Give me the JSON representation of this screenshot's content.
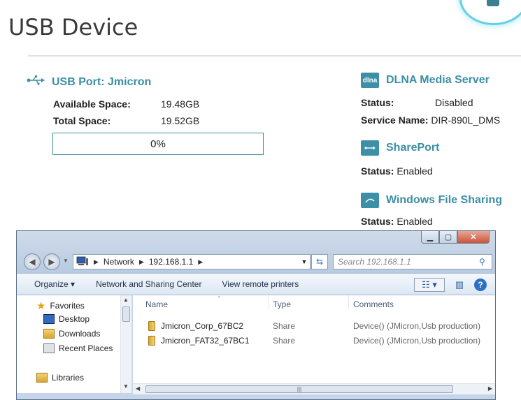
{
  "page": {
    "title": "USB Device"
  },
  "usb": {
    "port_label": "USB Port: Jmicron",
    "available_label": "Available Space:",
    "available_value": "19.48GB",
    "total_label": "Total Space:",
    "total_value": "19.52GB",
    "usage_text": "0%",
    "usage_fraction": 0
  },
  "dlna": {
    "title": "DLNA Media Server",
    "icon_text": "dlna",
    "status_label": "Status:",
    "status_value": "Disabled",
    "service_label": "Service Name:",
    "service_value": "DIR-890L_DMS"
  },
  "shareport": {
    "title": "SharePort",
    "status_label": "Status:",
    "status_value": "Enabled"
  },
  "wfs": {
    "title": "Windows File Sharing",
    "status_label": "Status:",
    "status_value": "Enabled"
  },
  "explorer": {
    "address": [
      "Network",
      "192.168.1.1"
    ],
    "search_placeholder": "Search 192.168.1.1",
    "toolbar": {
      "organize": "Organize",
      "network_center": "Network and Sharing Center",
      "remote_printers": "View remote printers"
    },
    "nav": {
      "favorites": "Favorites",
      "desktop": "Desktop",
      "downloads": "Downloads",
      "recent": "Recent Places",
      "libraries": "Libraries"
    },
    "columns": {
      "name": "Name",
      "type": "Type",
      "comments": "Comments"
    },
    "rows": [
      {
        "name": "Jmicron_Corp_67BC2",
        "type": "Share",
        "comment": "Device() (JMicron,Usb production)"
      },
      {
        "name": "Jmicron_FAT32_67BC1",
        "type": "Share",
        "comment": "Device() (JMicron,Usb production)"
      }
    ]
  },
  "colors": {
    "accent": "#3b8fa6",
    "ring": "#5fd0e6"
  }
}
